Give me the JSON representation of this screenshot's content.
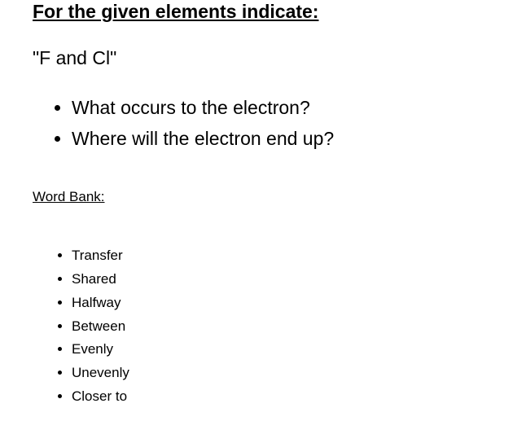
{
  "heading": "For the given elements indicate:",
  "elements": "\"F and Cl\"",
  "questions": [
    "What occurs to the electron?",
    "Where will the electron end up?"
  ],
  "wordBankHeading": "Word Bank:",
  "wordBank": [
    "Transfer",
    "Shared",
    "Halfway",
    "Between",
    "Evenly",
    "Unevenly",
    "Closer to"
  ]
}
